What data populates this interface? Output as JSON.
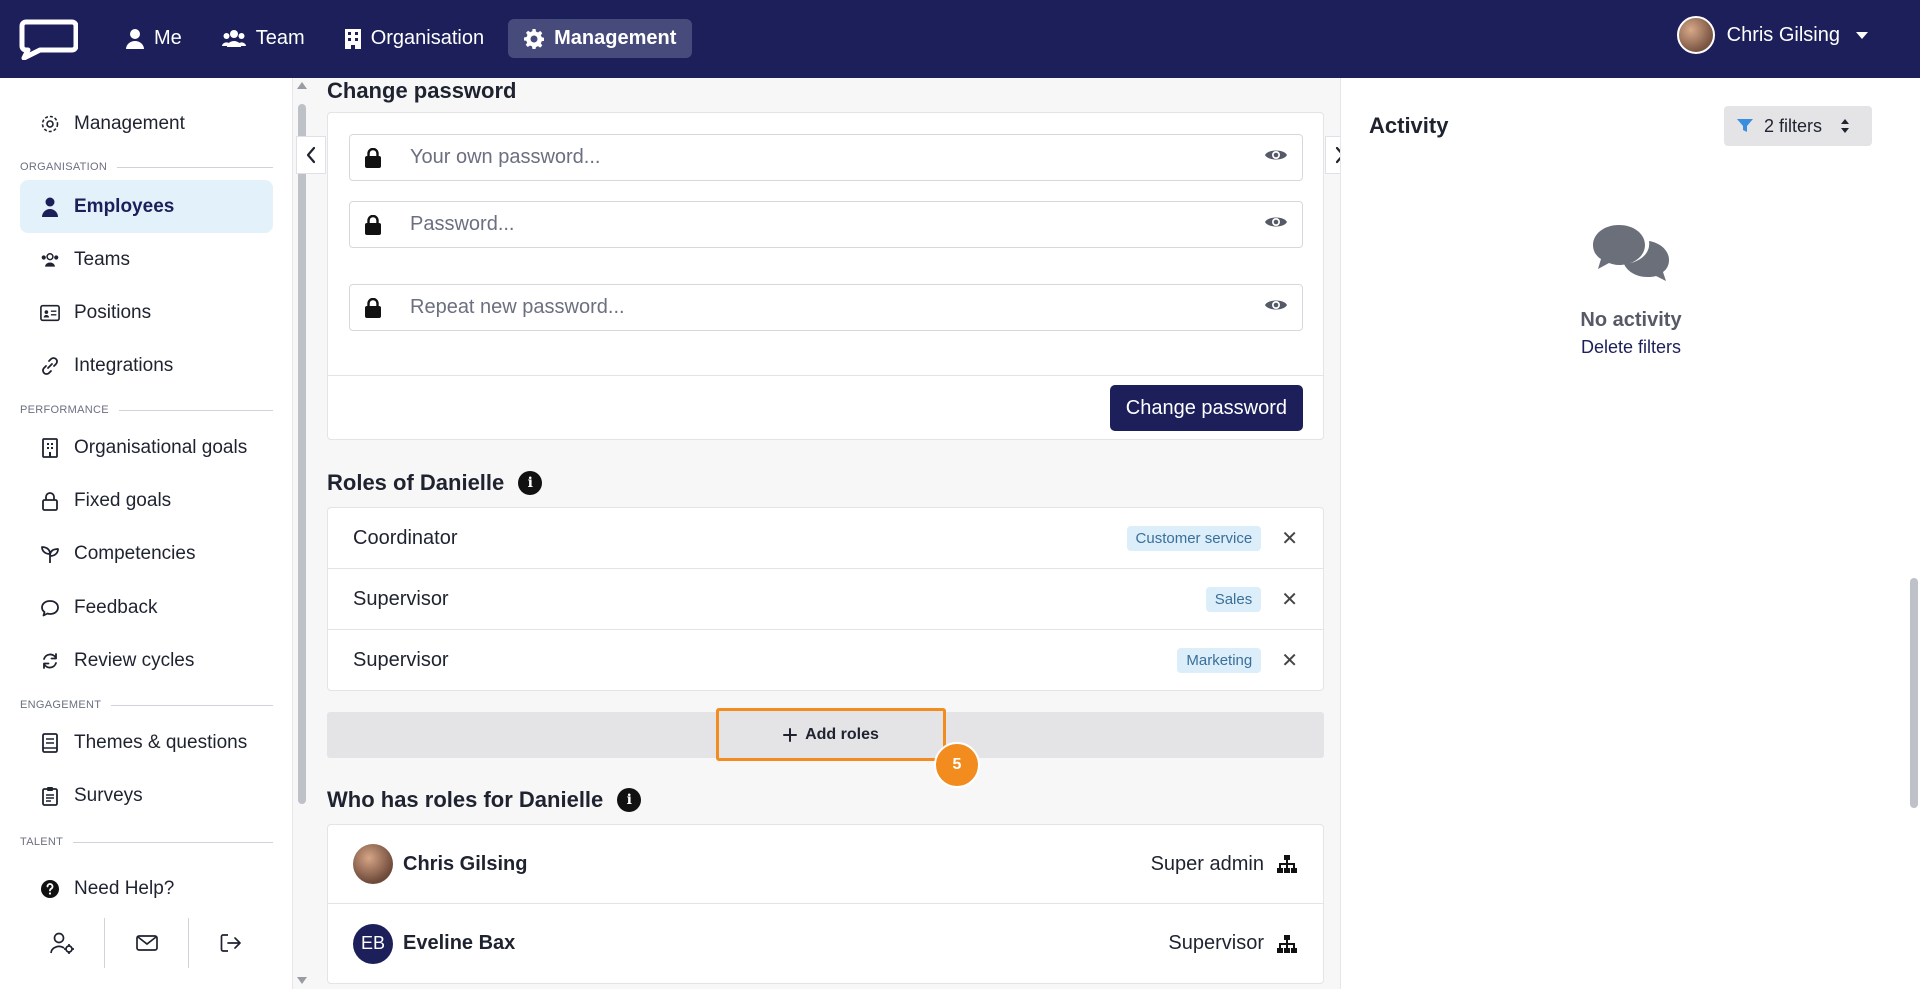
{
  "nav": {
    "items": [
      {
        "label": "Me",
        "icon": "user-icon"
      },
      {
        "label": "Team",
        "icon": "users-icon"
      },
      {
        "label": "Organisation",
        "icon": "building-icon"
      },
      {
        "label": "Management",
        "icon": "gear-icon",
        "active": true
      }
    ],
    "user_name": "Chris Gilsing"
  },
  "sidebar": {
    "header": "Management",
    "sections": {
      "organisation": "ORGANISATION",
      "performance": "PERFORMANCE",
      "engagement": "ENGAGEMENT",
      "talent": "TALENT"
    },
    "items": [
      {
        "label": "Employees",
        "active": true
      },
      {
        "label": "Teams"
      },
      {
        "label": "Positions"
      },
      {
        "label": "Integrations"
      },
      {
        "label": "Organisational goals"
      },
      {
        "label": "Fixed goals"
      },
      {
        "label": "Competencies"
      },
      {
        "label": "Feedback"
      },
      {
        "label": "Review cycles"
      },
      {
        "label": "Themes & questions"
      },
      {
        "label": "Surveys"
      },
      {
        "label": "Need Help?"
      }
    ]
  },
  "password": {
    "title": "Change password",
    "own_placeholder": "Your own password...",
    "new_placeholder": "Password...",
    "repeat_placeholder": "Repeat new password...",
    "submit_label": "Change password"
  },
  "roles": {
    "title": "Roles of Danielle",
    "rows": [
      {
        "name": "Coordinator",
        "tag": "Customer service"
      },
      {
        "name": "Supervisor",
        "tag": "Sales"
      },
      {
        "name": "Supervisor",
        "tag": "Marketing"
      }
    ],
    "add_label": "Add roles",
    "step_number": "5"
  },
  "who": {
    "title": "Who has roles for Danielle",
    "rows": [
      {
        "name": "Chris Gilsing",
        "role": "Super admin",
        "initials": ""
      },
      {
        "name": "Eveline Bax",
        "role": "Supervisor",
        "initials": "EB"
      }
    ]
  },
  "activity": {
    "title": "Activity",
    "filters_label": "2 filters",
    "empty_title": "No activity",
    "empty_link": "Delete filters"
  },
  "colors": {
    "navy": "#1c1f5a",
    "accent_orange": "#f28c1e",
    "tag_bg": "#dceefa",
    "active_item_bg": "#e3f1fb"
  }
}
